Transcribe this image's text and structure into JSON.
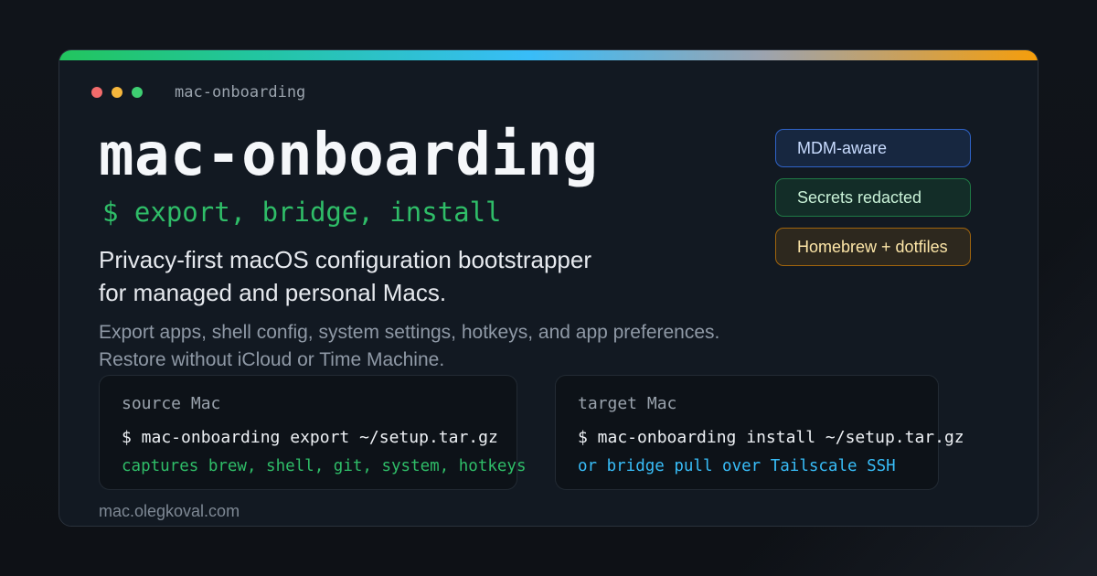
{
  "window": {
    "title": "mac-onboarding"
  },
  "hero": {
    "headline": "mac-onboarding",
    "command_line": "$ export, bridge, install",
    "description_lines": [
      "Privacy-first macOS configuration bootstrapper",
      "for managed and personal Macs."
    ],
    "subdescription_lines": [
      "Export apps, shell config, system settings, hotkeys, and app preferences.",
      "Restore without iCloud or Time Machine."
    ]
  },
  "badges": [
    {
      "label": "MDM-aware",
      "color": "#3b82f6"
    },
    {
      "label": "Secrets redacted",
      "color": "#22c55e"
    },
    {
      "label": "Homebrew + dotfiles",
      "color": "#f59e0b"
    }
  ],
  "terminals": [
    {
      "label": "source Mac",
      "command": "$ mac-onboarding export ~/setup.tar.gz",
      "note": "captures brew, shell, git, system, hotkeys",
      "note_color": "#2fbd68"
    },
    {
      "label": "target Mac",
      "command": "$ mac-onboarding install ~/setup.tar.gz",
      "note": "or bridge pull over Tailscale SSH",
      "note_color": "#38bdf8"
    }
  ],
  "footer": {
    "url": "mac.olegkoval.com"
  },
  "colors": {
    "traffic_close": "#f26b6b",
    "traffic_minimize": "#f6b73c",
    "traffic_maximize": "#3ecf72",
    "accent_gradient": [
      "#22c55e",
      "#38bdf8",
      "#f59e0b"
    ]
  },
  "icons": [
    "close-dot-icon",
    "minimize-dot-icon",
    "maximize-dot-icon"
  ]
}
